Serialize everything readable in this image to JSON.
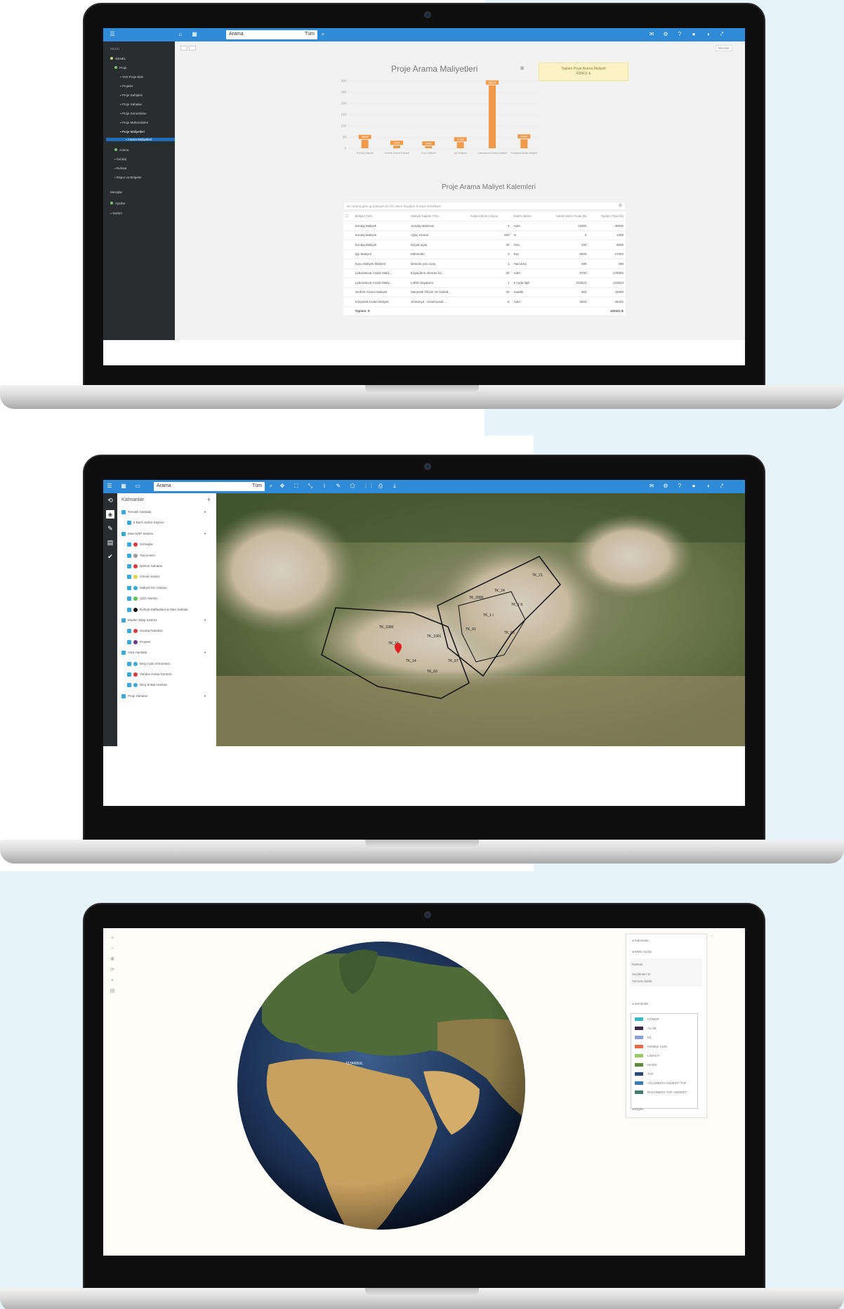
{
  "screen1": {
    "search": "Arama",
    "search_filter": "Tüm",
    "toolbar_right": "Menüler",
    "sidebar": {
      "header": "MENÜ",
      "items": [
        {
          "label": "GENEL"
        },
        {
          "label": "Proje"
        },
        {
          "label": "Yeni Proje Ekle"
        },
        {
          "label": "Projeler"
        },
        {
          "label": "Proje Sahipleri"
        },
        {
          "label": "Proje Sahaları"
        },
        {
          "label": "Proje Sorumluları"
        },
        {
          "label": "Proje Mühendisleri"
        },
        {
          "label": "Proje Maliyetleri"
        },
        {
          "label": "Arama Maliyetleri"
        },
        {
          "label": "Arama"
        },
        {
          "label": "Sondaj"
        },
        {
          "label": "Ruhsat"
        },
        {
          "label": "Rapor ve Belgeler"
        },
        {
          "label": "Mesajlar"
        },
        {
          "label": "Ayarlar"
        },
        {
          "label": "Yardım"
        }
      ]
    },
    "chart_data": {
      "type": "bar",
      "title": "Proje Arama Maliyetleri",
      "categories": [
        "Sondaj Maliyeti",
        "Jeofizik Arama Maliyeti",
        "Kuyu Maliyeti",
        "İşçi Maliyeti",
        "Laboratuvar Analiz Maliyeti",
        "Kimyasal Analiz Maliyeti"
      ],
      "values": [
        38000,
        12000,
        9000,
        27000,
        280000,
        40000
      ],
      "data_labels": [
        "38000",
        "12000",
        "9000",
        "27000",
        "280000",
        "40000"
      ],
      "yticks": [
        "0",
        "50",
        "100",
        "150",
        "200",
        "250",
        "300"
      ],
      "ylim": [
        0,
        300000
      ],
      "color": "#f29a4a"
    },
    "summary": {
      "title": "Toplam Proje Arama Maliyeti",
      "value": "428411 ₺"
    },
    "table_title": "Proje Arama Maliyet Kalemleri",
    "table_hint": "Bu sütuna göre gruplamak için bir sütun başlığını buraya sürükleyin",
    "table": {
      "columns": [
        "Maliyet Türü",
        "Maliyet Kalemi Türü",
        "Kalem Birimi Sayısı",
        "Kalem Birimi",
        "Kalem Birim Fiyatı (₺)",
        "Toplam Fiyat (₺)"
      ],
      "rows": [
        [
          "Sondaj Maliyeti",
          "Sondaj Makinesi",
          "4",
          "Adet",
          "12000",
          "48000"
        ],
        [
          "Sondaj Maliyeti",
          "Ağaç Kesimi",
          "200",
          "m",
          "6",
          "1200"
        ],
        [
          "Sondaj Maliyeti",
          "Kaçak ayaş",
          "30",
          "Gün",
          "200",
          "6000"
        ],
        [
          "İşçi Maliyeti",
          "Mühendis",
          "3",
          "Kişi",
          "9000",
          "27000"
        ],
        [
          "Kuyu Maliyeti Maliyeti",
          "Betonla yolu açışı",
          "1",
          "Harcama",
          "498",
          "498"
        ],
        [
          "Laboratuvar Analiz Maliy...",
          "Kayaçların eleman ko...",
          "20",
          "Adet",
          "8700",
          "175000"
        ],
        [
          "Laboratuvar Analiz Maliy...",
          "Lütfen kayaların",
          "1",
          "6 Ayda İlgili",
          "123523",
          "123523"
        ],
        [
          "Jeofizik Arama Maliyeti",
          "Manyetik Ölçüm Ve Harital...",
          "20",
          "Saatlik",
          "553",
          "11060"
        ],
        [
          "Kimyasal Analiz Maliyeti",
          "Jeokimya - renkmoosal ...",
          "8",
          "Adet",
          "5804",
          "46432"
        ]
      ],
      "total_label": "Toplam: 9",
      "total_value": "428411 ₺"
    }
  },
  "screen2": {
    "search": "Arama",
    "search_filter": "Tüm",
    "layers_title": "Katmanlar",
    "layers": [
      {
        "label": "Temalık Haritalar",
        "type": "group"
      },
      {
        "label": "5 Bach Sahar Saylaro",
        "type": "child"
      },
      {
        "label": "Mine ERP Sistemi",
        "type": "group"
      },
      {
        "label": "Sondajlar",
        "type": "child",
        "color": "#d63a3a"
      },
      {
        "label": "Tarçemeler",
        "type": "child",
        "color": "#9b9b9b"
      },
      {
        "label": "İşletme Sahaları",
        "type": "child",
        "color": "#d63a3a"
      },
      {
        "label": "Görsel Alanlar",
        "type": "child",
        "color": "#e6d24a"
      },
      {
        "label": "Maliyet Giri Alanları",
        "type": "child",
        "color": "#3aa9d8"
      },
      {
        "label": "ÇED Alanları",
        "type": "child",
        "color": "#5bbf56"
      },
      {
        "label": "Ruhsat Daffaatlarına Olan Sahalar",
        "type": "child",
        "color": "#111111"
      },
      {
        "label": "Maden Takip Sistemi",
        "type": "group"
      },
      {
        "label": "Sondaj Noktaları",
        "type": "child",
        "color": "#d63a3a"
      },
      {
        "label": "Projeler",
        "type": "child",
        "color": "#6a3a8a"
      },
      {
        "label": "Arka Haritalar",
        "type": "group"
      },
      {
        "label": "Bing Uydu Görüntüsü",
        "type": "child",
        "color": "#3aa9d8"
      },
      {
        "label": "Yandex Harita Görüntü",
        "type": "child",
        "color": "#d63a3a"
      },
      {
        "label": "Bing Sokak Haritası",
        "type": "child",
        "color": "#3aa9d8"
      },
      {
        "label": "Proje Sahaları",
        "type": "group"
      }
    ],
    "map_labels": [
      "TK_1000",
      "TK_1001",
      "TK_2000",
      "TK_1 I",
      "TK_1 K",
      "TK_24",
      "TK_21",
      "TK_14",
      "TK_63",
      "TK_67",
      "TK_65",
      "TK_16",
      "TK_41"
    ]
  },
  "screen3": {
    "panel_header": "Katmanlar",
    "panel_sub": "WMS Harita",
    "panel_items": [
      "Katman",
      "Seçilenleri sil",
      "Tümünü kaldır"
    ],
    "legend_header": "Semboller",
    "legend_items": [
      {
        "label": "KÖMÜR",
        "color": "#38b7c6"
      },
      {
        "label": "ALÜM",
        "color": "#3c2a4a"
      },
      {
        "label": "KİL",
        "color": "#8b9fd6"
      },
      {
        "label": "KIRMIZI KUM",
        "color": "#e86a4a"
      },
      {
        "label": "LİMAKİT",
        "color": "#9ac86a"
      },
      {
        "label": "MARN",
        "color": "#5a8a3a"
      },
      {
        "label": "TÜF",
        "color": "#2a4a7a"
      },
      {
        "label": "AGLOMERA ANDEZİT TÜF",
        "color": "#3a7ab0"
      },
      {
        "label": "ROLOMERA-TÜF ANDEZİT",
        "color": "#3f7a6a"
      }
    ],
    "footer": "Bilgiler",
    "globe_label": "İSTANBUL"
  }
}
